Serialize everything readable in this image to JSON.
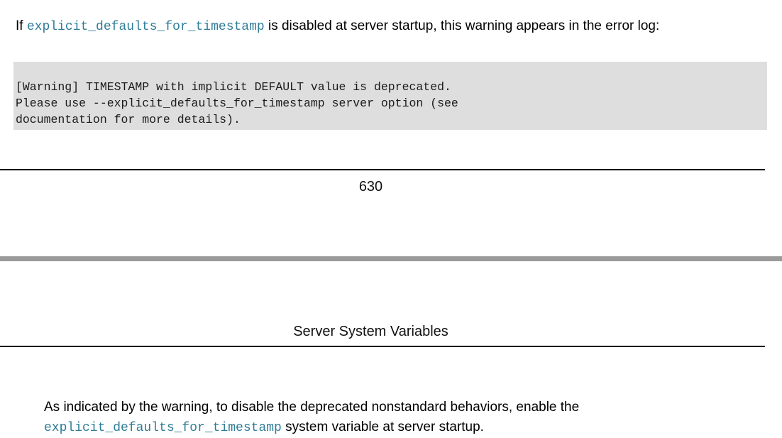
{
  "document": {
    "page_number": "630",
    "section_title": "Server System Variables",
    "intro_paragraph": {
      "lead": "If ",
      "variable": "explicit_defaults_for_timestamp",
      "tail": " is disabled at server startup, this warning appears in the error log:"
    },
    "warning_block": {
      "text": "[Warning] TIMESTAMP with implicit DEFAULT value is deprecated.\nPlease use --explicit_defaults_for_timestamp server option (see\ndocumentation for more details).",
      "background_color": "#dededf"
    },
    "closing_paragraph": {
      "lead": "As indicated by the warning, to disable the deprecated nonstandard behaviors, enable the ",
      "variable": "explicit_defaults_for_timestamp",
      "tail": " system variable at server startup."
    },
    "colors": {
      "variable_link": "#2f7c96",
      "rule": "#000000",
      "page_break_band": "#9a9a9a",
      "text": "#000000"
    }
  }
}
